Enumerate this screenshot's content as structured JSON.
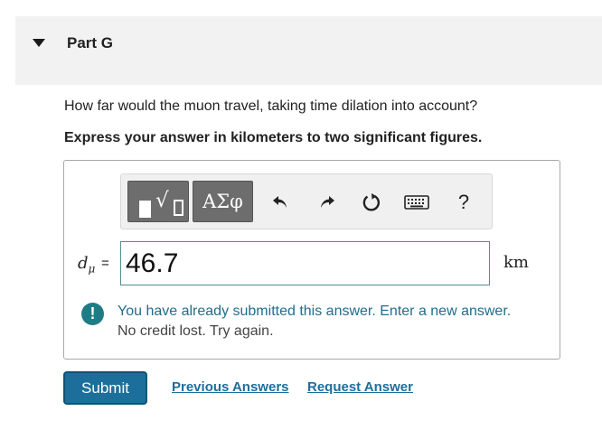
{
  "part": {
    "title": "Part G",
    "icon": "caret-down-icon"
  },
  "question": {
    "text": "How far would the muon travel, taking time dilation into account?",
    "instruction": "Express your answer in kilometers to two significant figures."
  },
  "toolbar": {
    "templates_icon": "templates-icon",
    "greek_label": "ΑΣφ",
    "undo_icon": "undo-icon",
    "redo_icon": "redo-icon",
    "reset_icon": "reset-icon",
    "keyboard_icon": "keyboard-icon",
    "help_label": "?"
  },
  "answer": {
    "variable": "d",
    "subscript": "μ",
    "equals": "=",
    "value": "46.7",
    "unit": "km"
  },
  "feedback": {
    "icon": "exclamation-icon",
    "icon_glyph": "!",
    "main": "You have already submitted this answer. Enter a new answer.",
    "sub": "No credit lost. Try again."
  },
  "actions": {
    "submit_label": "Submit",
    "previous_answers_label": "Previous Answers",
    "request_answer_label": "Request Answer"
  },
  "colors": {
    "accent": "#1c6f9a",
    "feedback_text": "#1f6e8c",
    "header_bg": "#f2f2f2",
    "toolbar_dark": "#6d6d6d"
  }
}
